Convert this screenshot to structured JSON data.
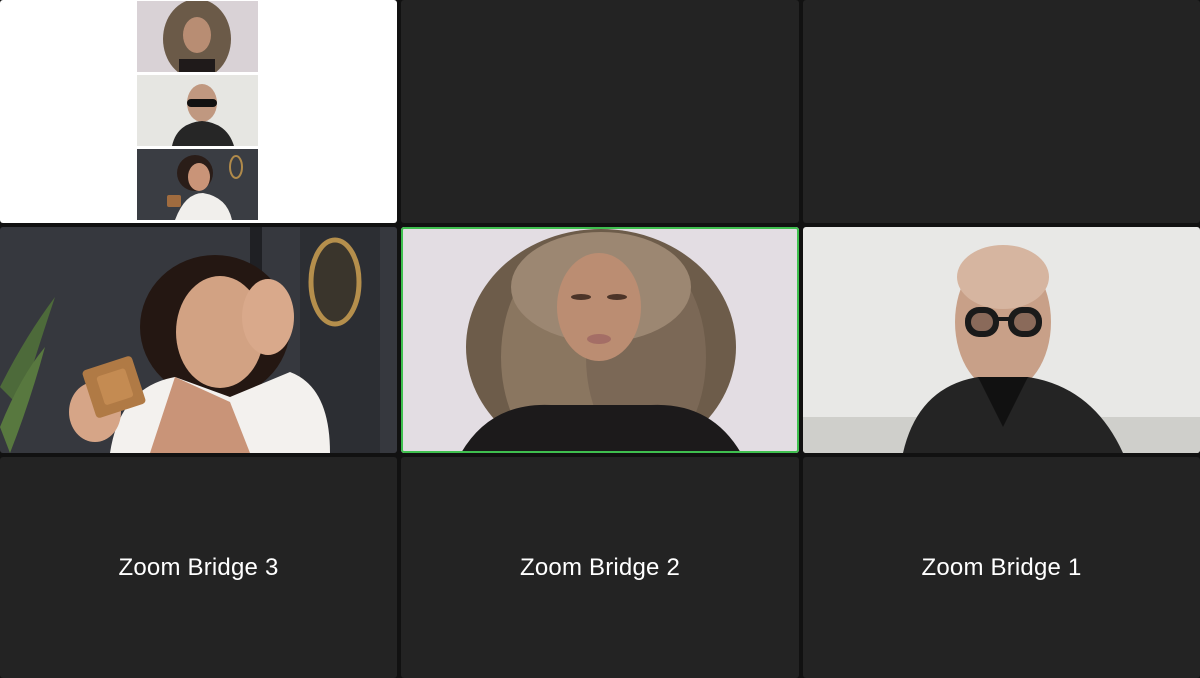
{
  "meeting": {
    "gallery_strip": {
      "thumbnails": [
        {
          "participant": "curly-hair-woman"
        },
        {
          "participant": "man-with-glasses"
        },
        {
          "participant": "woman-with-perfume"
        }
      ]
    },
    "tiles": {
      "bridge3": {
        "label": "Zoom Bridge 3"
      },
      "bridge2": {
        "label": "Zoom Bridge 2"
      },
      "bridge1": {
        "label": "Zoom Bridge 1"
      }
    },
    "active_speaker_color": "#3fbf4f"
  }
}
